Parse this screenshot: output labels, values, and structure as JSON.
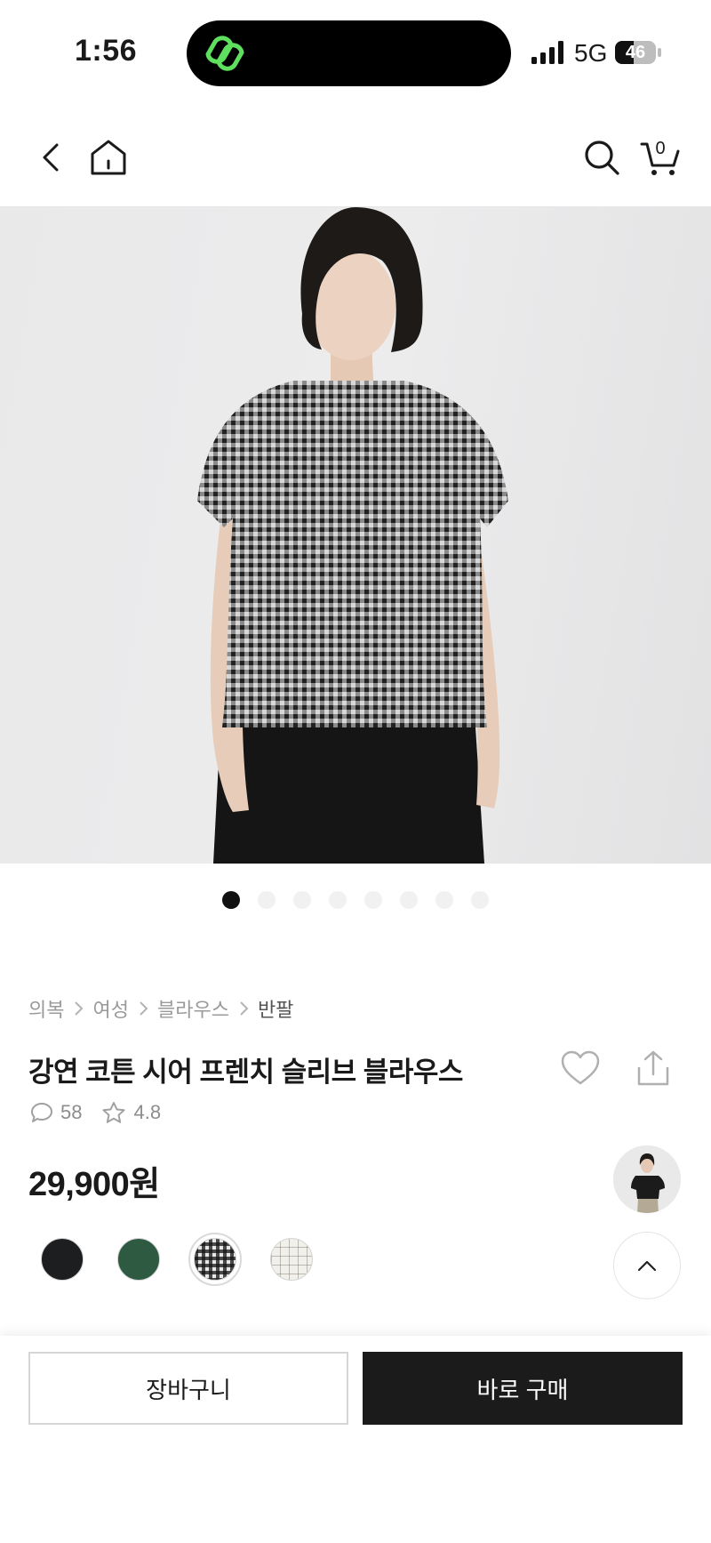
{
  "status_bar": {
    "time": "1:56",
    "network": "5G",
    "battery": "46",
    "battery_level": 0.46,
    "icons": [
      "app-logo-icon",
      "signal-icon",
      "battery-icon"
    ]
  },
  "nav": {
    "cart_count": "0",
    "icons": [
      "back-icon",
      "home-icon",
      "search-icon",
      "cart-icon"
    ]
  },
  "gallery": {
    "image": "model-wearing-gingham-blouse",
    "total_images": 8,
    "active_index": 0
  },
  "breadcrumb": [
    "의복",
    "여성",
    "블라우스",
    "반팔"
  ],
  "product": {
    "title": "강연 코튼 시어 프렌치 슬리브 블라우스",
    "review_count": "58",
    "rating": "4.8",
    "price": "29,900원",
    "icons": [
      "heart-icon",
      "share-icon",
      "comment-icon",
      "star-icon"
    ]
  },
  "swatches": [
    {
      "name": "black",
      "color": "#1c1e20",
      "selected": false
    },
    {
      "name": "green",
      "color": "#2f5a42",
      "selected": false
    },
    {
      "name": "black-gingham",
      "color": "#3a3a3a",
      "selected": true
    },
    {
      "name": "ivory-check",
      "color": "#f2f0ea",
      "selected": false
    }
  ],
  "actions": {
    "cart_label": "장바구니",
    "buy_label": "바로 구매"
  },
  "colors": {
    "primary_button": "#1b1b1b",
    "app_logo": "#5ee05e"
  }
}
